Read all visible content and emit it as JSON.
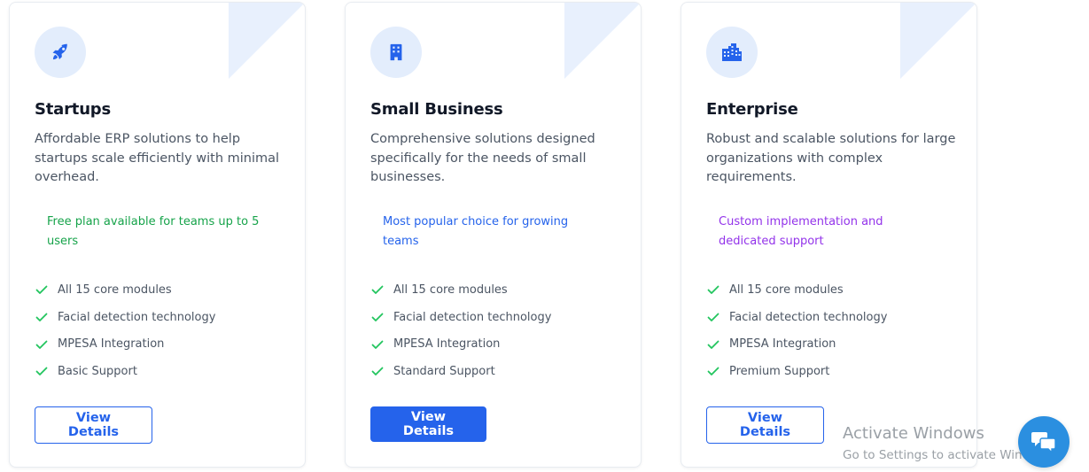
{
  "plans": [
    {
      "icon": "rocket-icon",
      "title": "Startups",
      "description": "Affordable ERP solutions to help startups scale efficiently with minimal overhead.",
      "highlight": "Free plan available for teams up to 5 users",
      "highlight_color": "#16a34a",
      "features": [
        "All 15 core modules",
        "Facial detection technology",
        "MPESA Integration",
        "Basic Support"
      ],
      "button_label": "View Details",
      "button_style": "outline"
    },
    {
      "icon": "building-icon",
      "title": "Small Business",
      "description": "Comprehensive solutions designed specifically for the needs of small businesses.",
      "highlight": "Most popular choice for growing teams",
      "highlight_color": "#2563eb",
      "features": [
        "All 15 core modules",
        "Facial detection technology",
        "MPESA Integration",
        "Standard Support"
      ],
      "button_label": "View Details",
      "button_style": "filled"
    },
    {
      "icon": "city-buildings-icon",
      "title": "Enterprise",
      "description": "Robust and scalable solutions for large organizations with complex requirements.",
      "highlight": "Custom implementation and dedicated support",
      "highlight_color": "#9333ea",
      "features": [
        "All 15 core modules",
        "Facial detection technology",
        "MPESA Integration",
        "Premium Support"
      ],
      "button_label": "View Details",
      "button_style": "outline"
    }
  ],
  "colors": {
    "accent": "#2563eb",
    "check": "#22c55e",
    "icon_bg": "#e3edfc",
    "chat_button": "#2b8fe0"
  },
  "watermark": {
    "line1": "Activate Windows",
    "line2": "Go to Settings to activate Windows."
  },
  "chat_widget": {
    "icon": "chat-bubbles-icon"
  }
}
